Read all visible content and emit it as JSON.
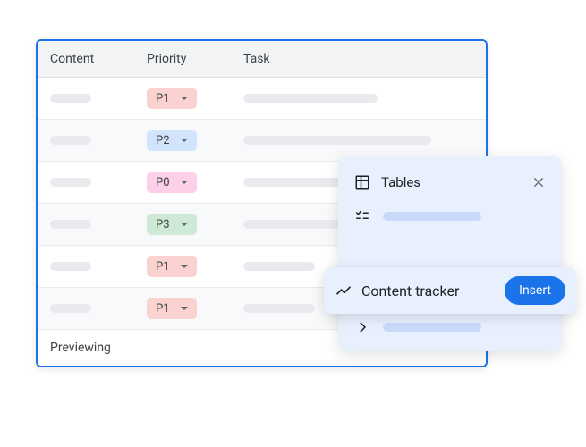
{
  "table": {
    "columns": [
      "Content",
      "Priority",
      "Task"
    ],
    "rows": [
      {
        "priority": "P1",
        "priorityClass": "chip-p1",
        "taskLen": "sk-task-mid"
      },
      {
        "priority": "P2",
        "priorityClass": "chip-p2",
        "taskLen": "sk-task-long"
      },
      {
        "priority": "P0",
        "priorityClass": "chip-p0",
        "taskLen": "sk-task-long"
      },
      {
        "priority": "P3",
        "priorityClass": "chip-p3",
        "taskLen": "sk-task-mid"
      },
      {
        "priority": "P1",
        "priorityClass": "chip-p1",
        "taskLen": "sk-task-short"
      },
      {
        "priority": "P1",
        "priorityClass": "chip-p1",
        "taskLen": "sk-task-short"
      }
    ],
    "footer": "Previewing"
  },
  "popup": {
    "title": "Tables",
    "highlighted": {
      "label": "Content tracker",
      "button": "Insert"
    }
  }
}
